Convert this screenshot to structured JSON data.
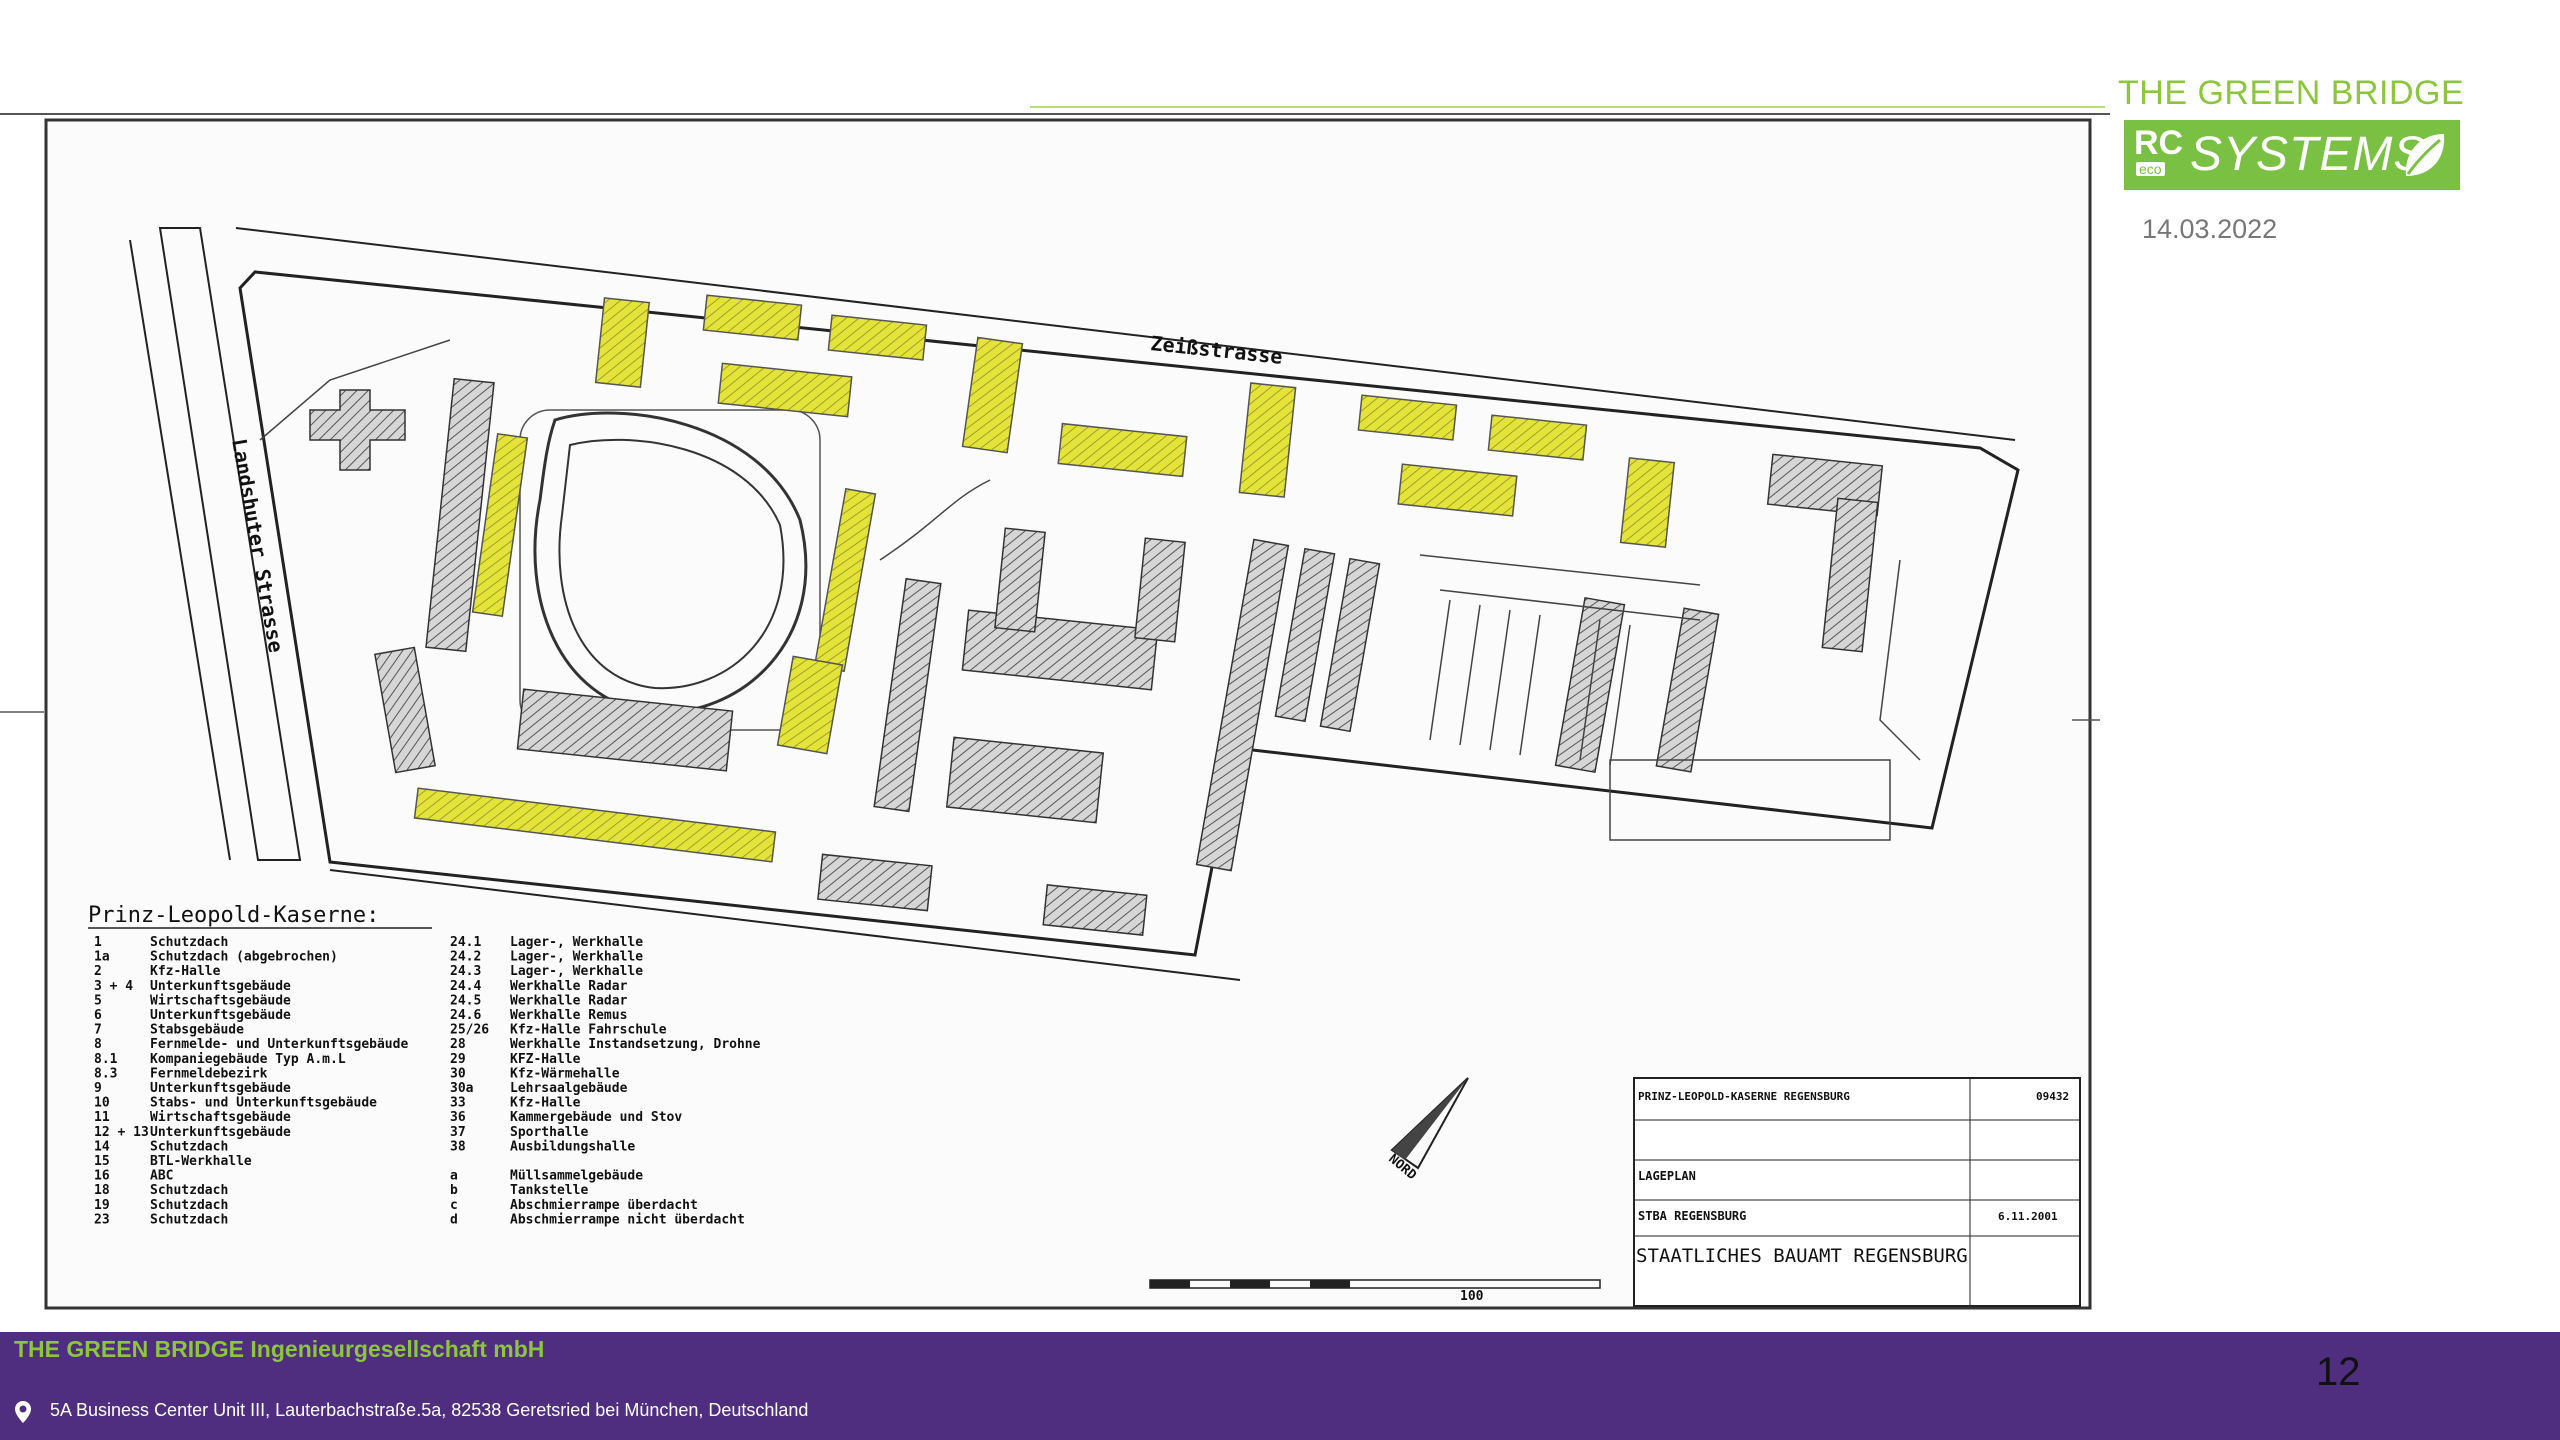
{
  "header": {
    "brand_title": "THE GREEN BRIDGE",
    "logo_rc": "RC",
    "logo_eco": "eco",
    "logo_systems": "SYSTEMS",
    "date": "14.03.2022"
  },
  "colors": {
    "brand_green": "#8cc63f",
    "footer_purple": "#4f2d7f",
    "highlight_yellow": "#e6e62e"
  },
  "map": {
    "street_top": "Zeißstrasse",
    "street_left": "Landshuter Strasse",
    "legend_title": "Prinz-Leopold-Kaserne:",
    "legend_left": [
      [
        "1",
        "Schutzdach"
      ],
      [
        "1a",
        "Schutzdach (abgebrochen)"
      ],
      [
        "2",
        "Kfz-Halle"
      ],
      [
        "3 + 4",
        "Unterkunftsgebäude"
      ],
      [
        "5",
        "Wirtschaftsgebäude"
      ],
      [
        "6",
        "Unterkunftsgebäude"
      ],
      [
        "7",
        "Stabsgebäude"
      ],
      [
        "8",
        "Fernmelde- und Unterkunftsgebäude"
      ],
      [
        "8.1",
        "Kompaniegebäude Typ A.m.L"
      ],
      [
        "8.3",
        "Fernmeldebezirk"
      ],
      [
        "9",
        "Unterkunftsgebäude"
      ],
      [
        "10",
        "Stabs- und Unterkunftsgebäude"
      ],
      [
        "11",
        "Wirtschaftsgebäude"
      ],
      [
        "12 + 13",
        "Unterkunftsgebäude"
      ],
      [
        "14",
        "Schutzdach"
      ],
      [
        "15",
        "BTL-Werkhalle"
      ],
      [
        "16",
        "ABC"
      ],
      [
        "18",
        "Schutzdach"
      ],
      [
        "19",
        "Schutzdach"
      ],
      [
        "23",
        "Schutzdach"
      ]
    ],
    "legend_right": [
      [
        "24.1",
        "Lager-, Werkhalle"
      ],
      [
        "24.2",
        "Lager-, Werkhalle"
      ],
      [
        "24.3",
        "Lager-, Werkhalle"
      ],
      [
        "24.4",
        "Werkhalle Radar"
      ],
      [
        "24.5",
        "Werkhalle Radar"
      ],
      [
        "24.6",
        "Werkhalle Remus"
      ],
      [
        "25/26",
        "Kfz-Halle Fahrschule"
      ],
      [
        "28",
        "Werkhalle Instandsetzung, Drohne"
      ],
      [
        "29",
        "KFZ-Halle"
      ],
      [
        "30",
        "Kfz-Wärmehalle"
      ],
      [
        "30a",
        "Lehrsaalgebäude"
      ],
      [
        "33",
        "Kfz-Halle"
      ],
      [
        "36",
        "Kammergebäude und Stov"
      ],
      [
        "37",
        "Sporthalle"
      ],
      [
        "38",
        "Ausbildungshalle"
      ],
      [
        "",
        ""
      ],
      [
        "a",
        "Müllsammelgebäude"
      ],
      [
        "b",
        "Tankstelle"
      ],
      [
        "c",
        "Abschmierrampe überdacht"
      ],
      [
        "d",
        "Abschmierrampe nicht überdacht"
      ]
    ],
    "north_label": "NORD",
    "titleblock": {
      "project": "PRINZ-LEOPOLD-KASERNE  REGENSBURG",
      "number": "09432",
      "plan": "LAGEPLAN",
      "office": "STBA REGENSBURG",
      "date": "6.11.2001",
      "authority": "STAATLICHES BAUAMT REGENSBURG"
    },
    "scale_label": "100"
  },
  "footer": {
    "company": "THE GREEN BRIDGE Ingenieurgesellschaft mbH",
    "address": "5A Business Center Unit III, Lauterbachstraße.5a, 82538 Geretsried bei München, Deutschland",
    "page_number": "12"
  }
}
